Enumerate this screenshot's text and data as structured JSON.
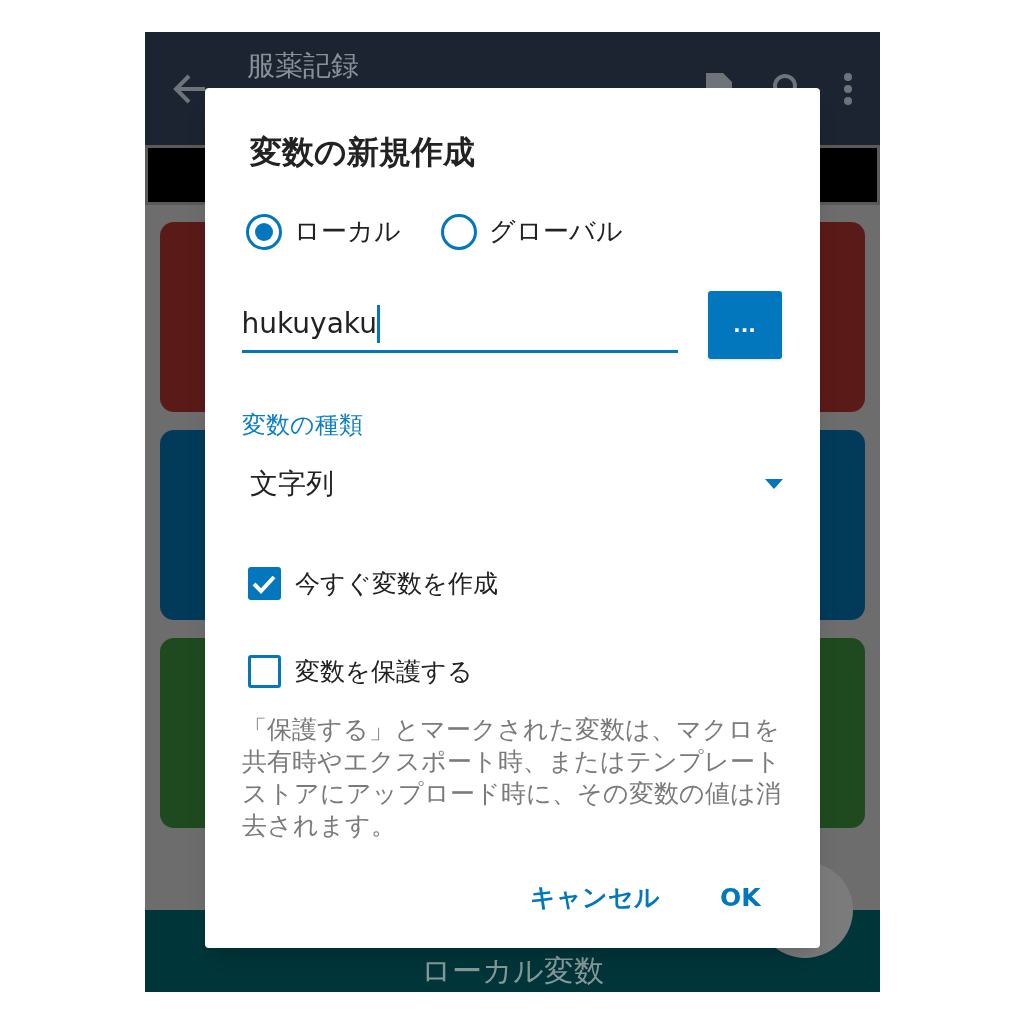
{
  "app_bar": {
    "title": "服薬記録"
  },
  "cards": [
    {
      "color": "#5a1a18"
    },
    {
      "color": "#023a5a"
    },
    {
      "color": "#1f4a1f"
    }
  ],
  "bottom_bar": {
    "label": "ローカル変数"
  },
  "dialog": {
    "title": "変数の新規作成",
    "scope": [
      {
        "label": "ローカル",
        "selected": true
      },
      {
        "label": "グローバル",
        "selected": false
      }
    ],
    "name_field": {
      "value": "hukuyaku"
    },
    "more_button": "...",
    "type_label": "変数の種類",
    "type_value": "文字列",
    "options": [
      {
        "label": "今すぐ変数を作成",
        "checked": true
      },
      {
        "label": "変数を保護する",
        "checked": false
      }
    ],
    "description": "「保護する」とマークされた変数は、マクロを共有時やエクスポート時、またはテンプレートストアにアップロード時に、その変数の値は消去されます。",
    "buttons": [
      "キャンセル",
      "OK"
    ]
  }
}
